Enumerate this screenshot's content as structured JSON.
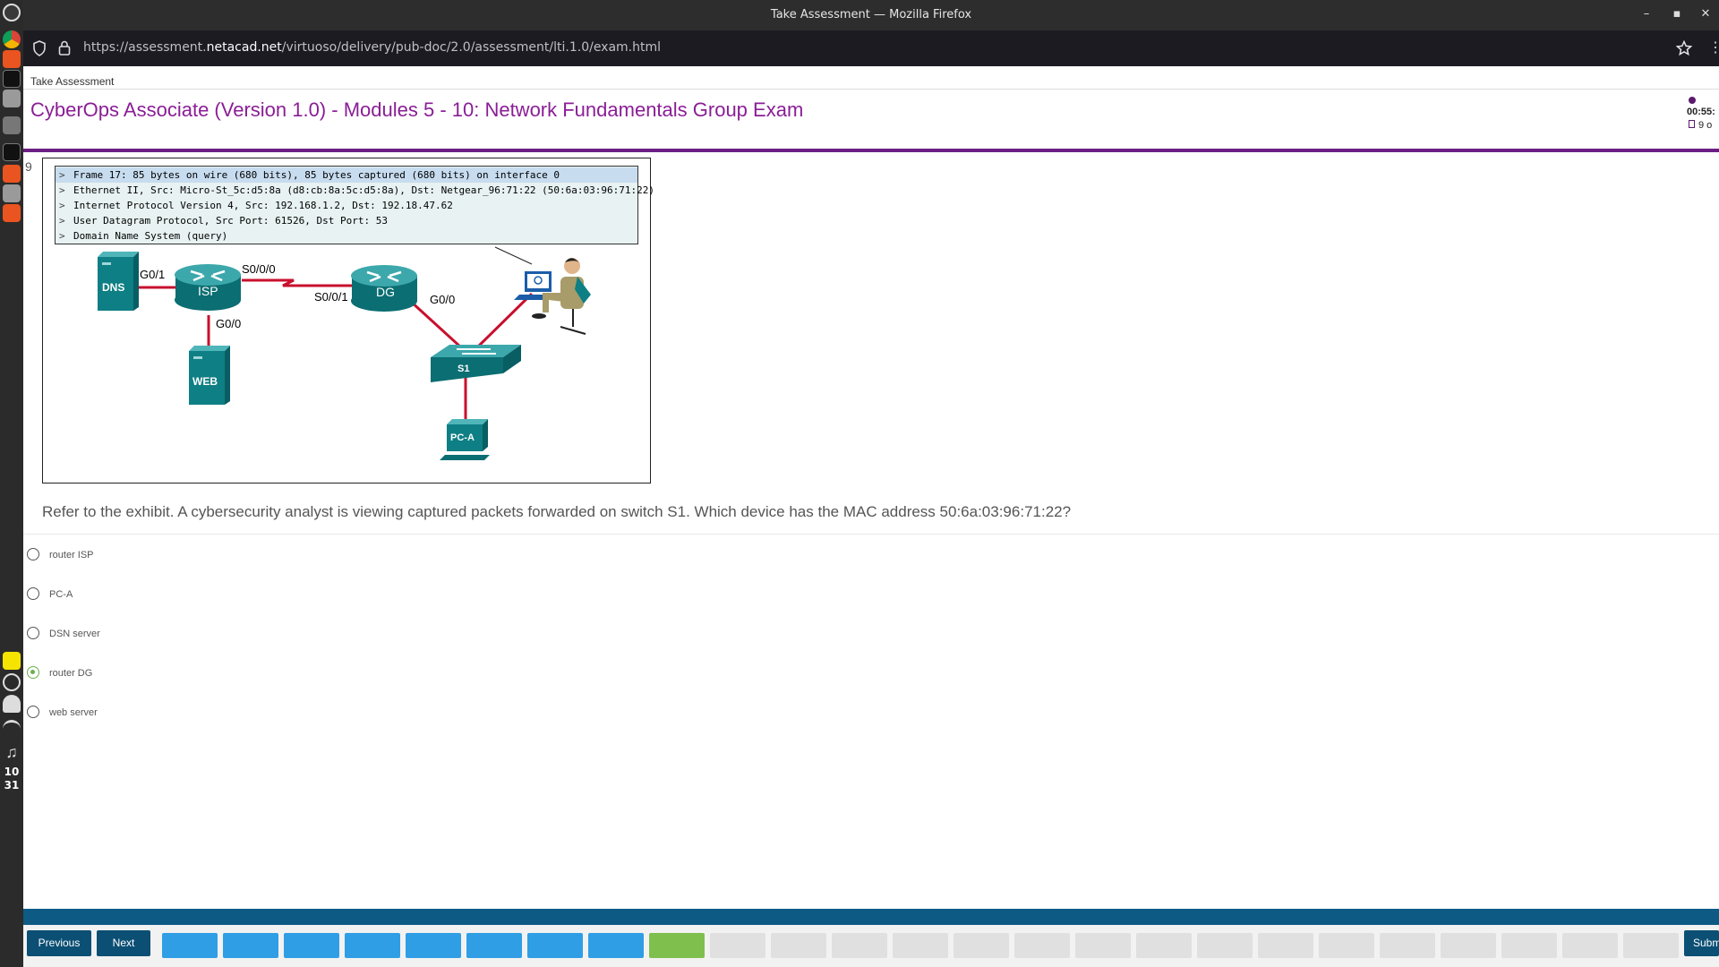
{
  "window": {
    "title": "Take Assessment — Mozilla Firefox",
    "url_prefix": "https://assessment.",
    "url_domain": "netacad.net",
    "url_path": "/virtuoso/delivery/pub-doc/2.0/assessment/lti.1.0/exam.html"
  },
  "dock": {
    "clock_hour": "10",
    "clock_min": "31"
  },
  "page": {
    "breadcrumb": "Take Assessment",
    "exam_title": "CyberOps Associate (Version 1.0) - Modules 5 - 10: Network Fundamentals Group Exam",
    "timer": "00:55:",
    "progress": "9 o"
  },
  "question": {
    "number": "9",
    "text": "Refer to the exhibit. A cybersecurity analyst is viewing captured packets forwarded on switch S1. Which device has the MAC address 50:6a:03:96:71:22?",
    "options": [
      {
        "label": "router ISP",
        "selected": false
      },
      {
        "label": "PC-A",
        "selected": false
      },
      {
        "label": "DSN server",
        "selected": false
      },
      {
        "label": "router DG",
        "selected": true
      },
      {
        "label": "web server",
        "selected": false
      }
    ]
  },
  "exhibit": {
    "packet_rows": [
      "Frame 17: 85 bytes on wire (680 bits), 85 bytes captured (680 bits) on interface 0",
      "Ethernet II, Src: Micro-St_5c:d5:8a (d8:cb:8a:5c:d5:8a), Dst: Netgear_96:71:22 (50:6a:03:96:71:22)",
      "Internet Protocol Version 4, Src: 192.168.1.2, Dst: 192.18.47.62",
      "User Datagram Protocol, Src Port: 61526, Dst Port: 53",
      "Domain Name System (query)"
    ],
    "caret": ">",
    "labels": {
      "dns": "DNS",
      "isp": "ISP",
      "dg": "DG",
      "web": "WEB",
      "s1": "S1",
      "pca": "PC-A",
      "isp_g01": "G0/1",
      "isp_s000": "S0/0/0",
      "dg_s001": "S0/0/1",
      "dg_g00": "G0/0",
      "isp_g00": "G0/0"
    },
    "colors": {
      "device": "#0e7f84",
      "link": "#c8102e"
    }
  },
  "nav": {
    "previous": "Previous",
    "next": "Next",
    "submit": "Subm",
    "question_boxes": [
      "done",
      "done",
      "done",
      "done",
      "done",
      "done",
      "done",
      "done",
      "cur",
      "todo",
      "todo",
      "todo",
      "todo",
      "todo",
      "todo",
      "todo",
      "todo",
      "todo",
      "todo",
      "todo",
      "todo",
      "todo",
      "todo",
      "todo",
      "todo",
      "todo"
    ]
  }
}
